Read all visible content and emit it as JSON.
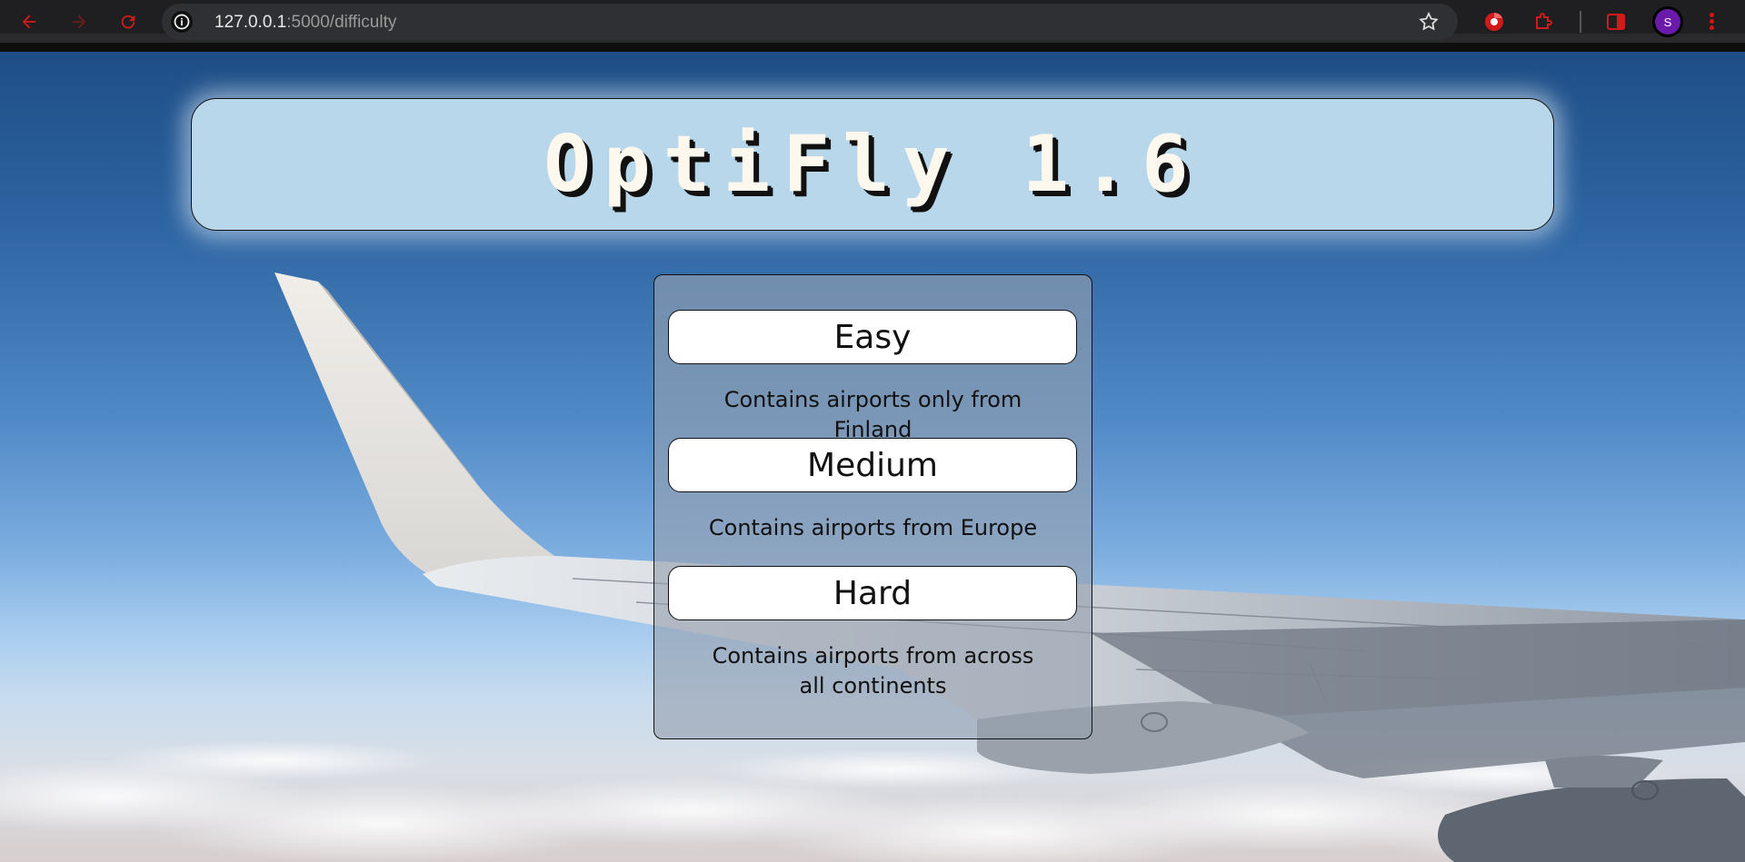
{
  "browser": {
    "url_host": "127.0.0.1",
    "url_path": ":5000/difficulty",
    "profile_initial": "S"
  },
  "banner": {
    "title": "OptiFly 1.6"
  },
  "difficulty": {
    "options": [
      {
        "label": "Easy",
        "description": "Contains airports only from Finland"
      },
      {
        "label": "Medium",
        "description": "Contains airports from Europe"
      },
      {
        "label": "Hard",
        "description": "Contains airports from across all continents"
      }
    ]
  },
  "colors": {
    "banner_bg": "#b8d7ea",
    "panel_bg": "rgba(150,160,175,0.62)",
    "button_bg": "#ffffff",
    "title_text": "#fdf8ee",
    "chrome_icons": "#d11a1a"
  }
}
